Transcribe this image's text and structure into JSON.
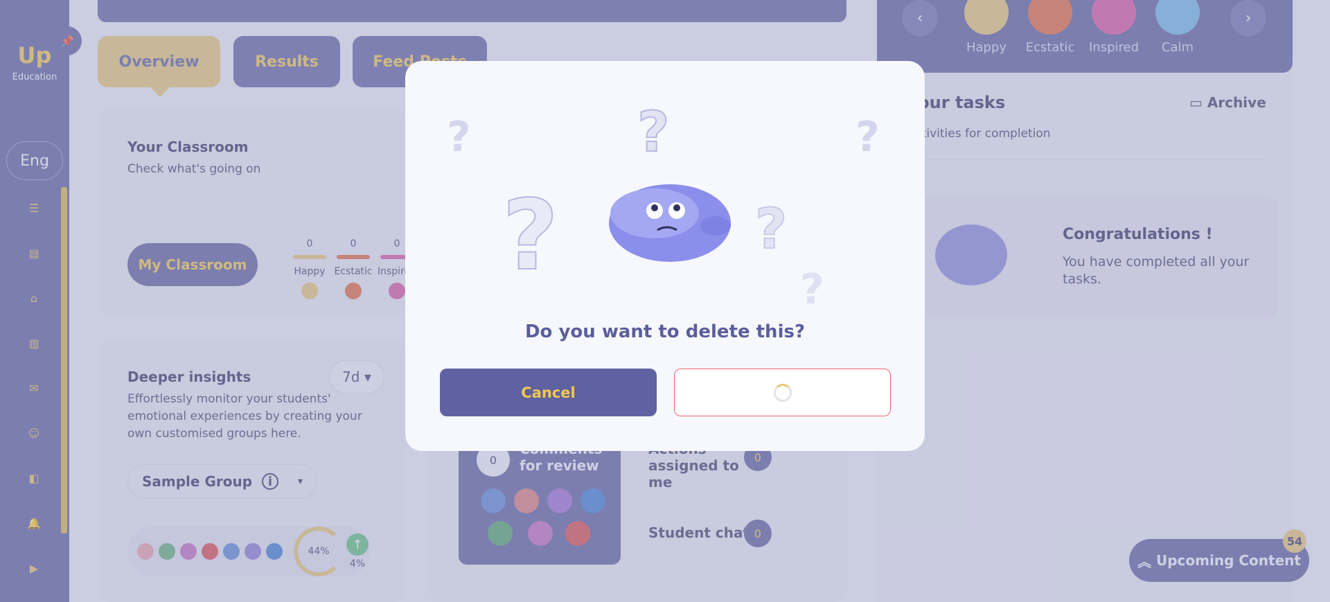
{
  "app": {
    "brand": "Education",
    "language": "Eng"
  },
  "tabs": [
    {
      "label": "Overview"
    },
    {
      "label": "Results"
    },
    {
      "label": "Feed Posts"
    }
  ],
  "classroom": {
    "title": "Your Classroom",
    "subtitle": "Check what's going on",
    "button": "My Classroom",
    "moods": [
      {
        "label": "Happy",
        "count": "0",
        "color": "#e6c773"
      },
      {
        "label": "Ecstatic",
        "count": "0",
        "color": "#e0663b"
      },
      {
        "label": "Inspired",
        "count": "0",
        "color": "#d9579e"
      }
    ]
  },
  "insights": {
    "title": "Deeper insights",
    "range": "7d",
    "description": "Effortlessly monitor your students' emotional experiences by creating your own customised groups here.",
    "group": "Sample Group",
    "percent": "44%",
    "delta": "4%"
  },
  "review": {
    "count": "0",
    "label": "Comments for review"
  },
  "actions": [
    {
      "label": "Actions assigned to me",
      "count": "0"
    },
    {
      "label": "Student chat",
      "count": "0"
    }
  ],
  "top_moods": [
    {
      "label": "Happy",
      "color": "#e6c773"
    },
    {
      "label": "Ecstatic",
      "color": "#e0663b"
    },
    {
      "label": "Inspired",
      "color": "#d9579e"
    },
    {
      "label": "Calm",
      "color": "#6fb6e6"
    }
  ],
  "tasks": {
    "title": "Your tasks",
    "subtitle": "Activities for completion",
    "archive": "Archive",
    "congrats_title": "Congratulations !",
    "congrats_text": "You have completed all your tasks."
  },
  "upcoming": {
    "label": "Upcoming Content",
    "badge": "54"
  },
  "modal": {
    "title": "Do you want to delete this?",
    "cancel": "Cancel"
  }
}
